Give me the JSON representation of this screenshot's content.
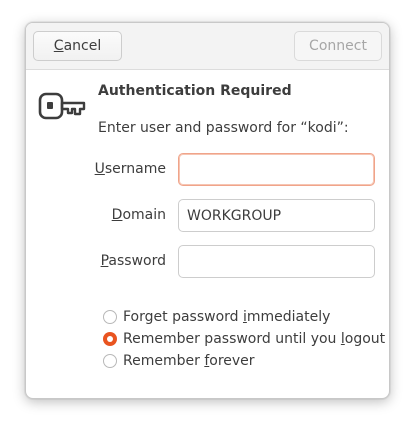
{
  "header": {
    "cancel": {
      "pre": "",
      "mn": "C",
      "post": "ancel"
    },
    "connect_label": "Connect"
  },
  "icon": "key-icon",
  "title": "Authentication Required",
  "message": "Enter user and password for “kodi”:",
  "fields": {
    "username": {
      "label_mn": "U",
      "label_post": "sername",
      "value": ""
    },
    "domain": {
      "label_mn": "D",
      "label_post": "omain",
      "value": "WORKGROUP"
    },
    "password": {
      "label_mn": "P",
      "label_post": "assword",
      "value": ""
    }
  },
  "options": [
    {
      "pre": "Forget password ",
      "mn": "i",
      "post": "mmediately",
      "checked": false
    },
    {
      "pre": "Remember password until you ",
      "mn": "l",
      "post": "ogout",
      "checked": true
    },
    {
      "pre": "Remember ",
      "mn": "f",
      "post": "orever",
      "checked": false
    }
  ],
  "colors": {
    "accent": "#e95420",
    "focus_border": "#f0a48a"
  }
}
